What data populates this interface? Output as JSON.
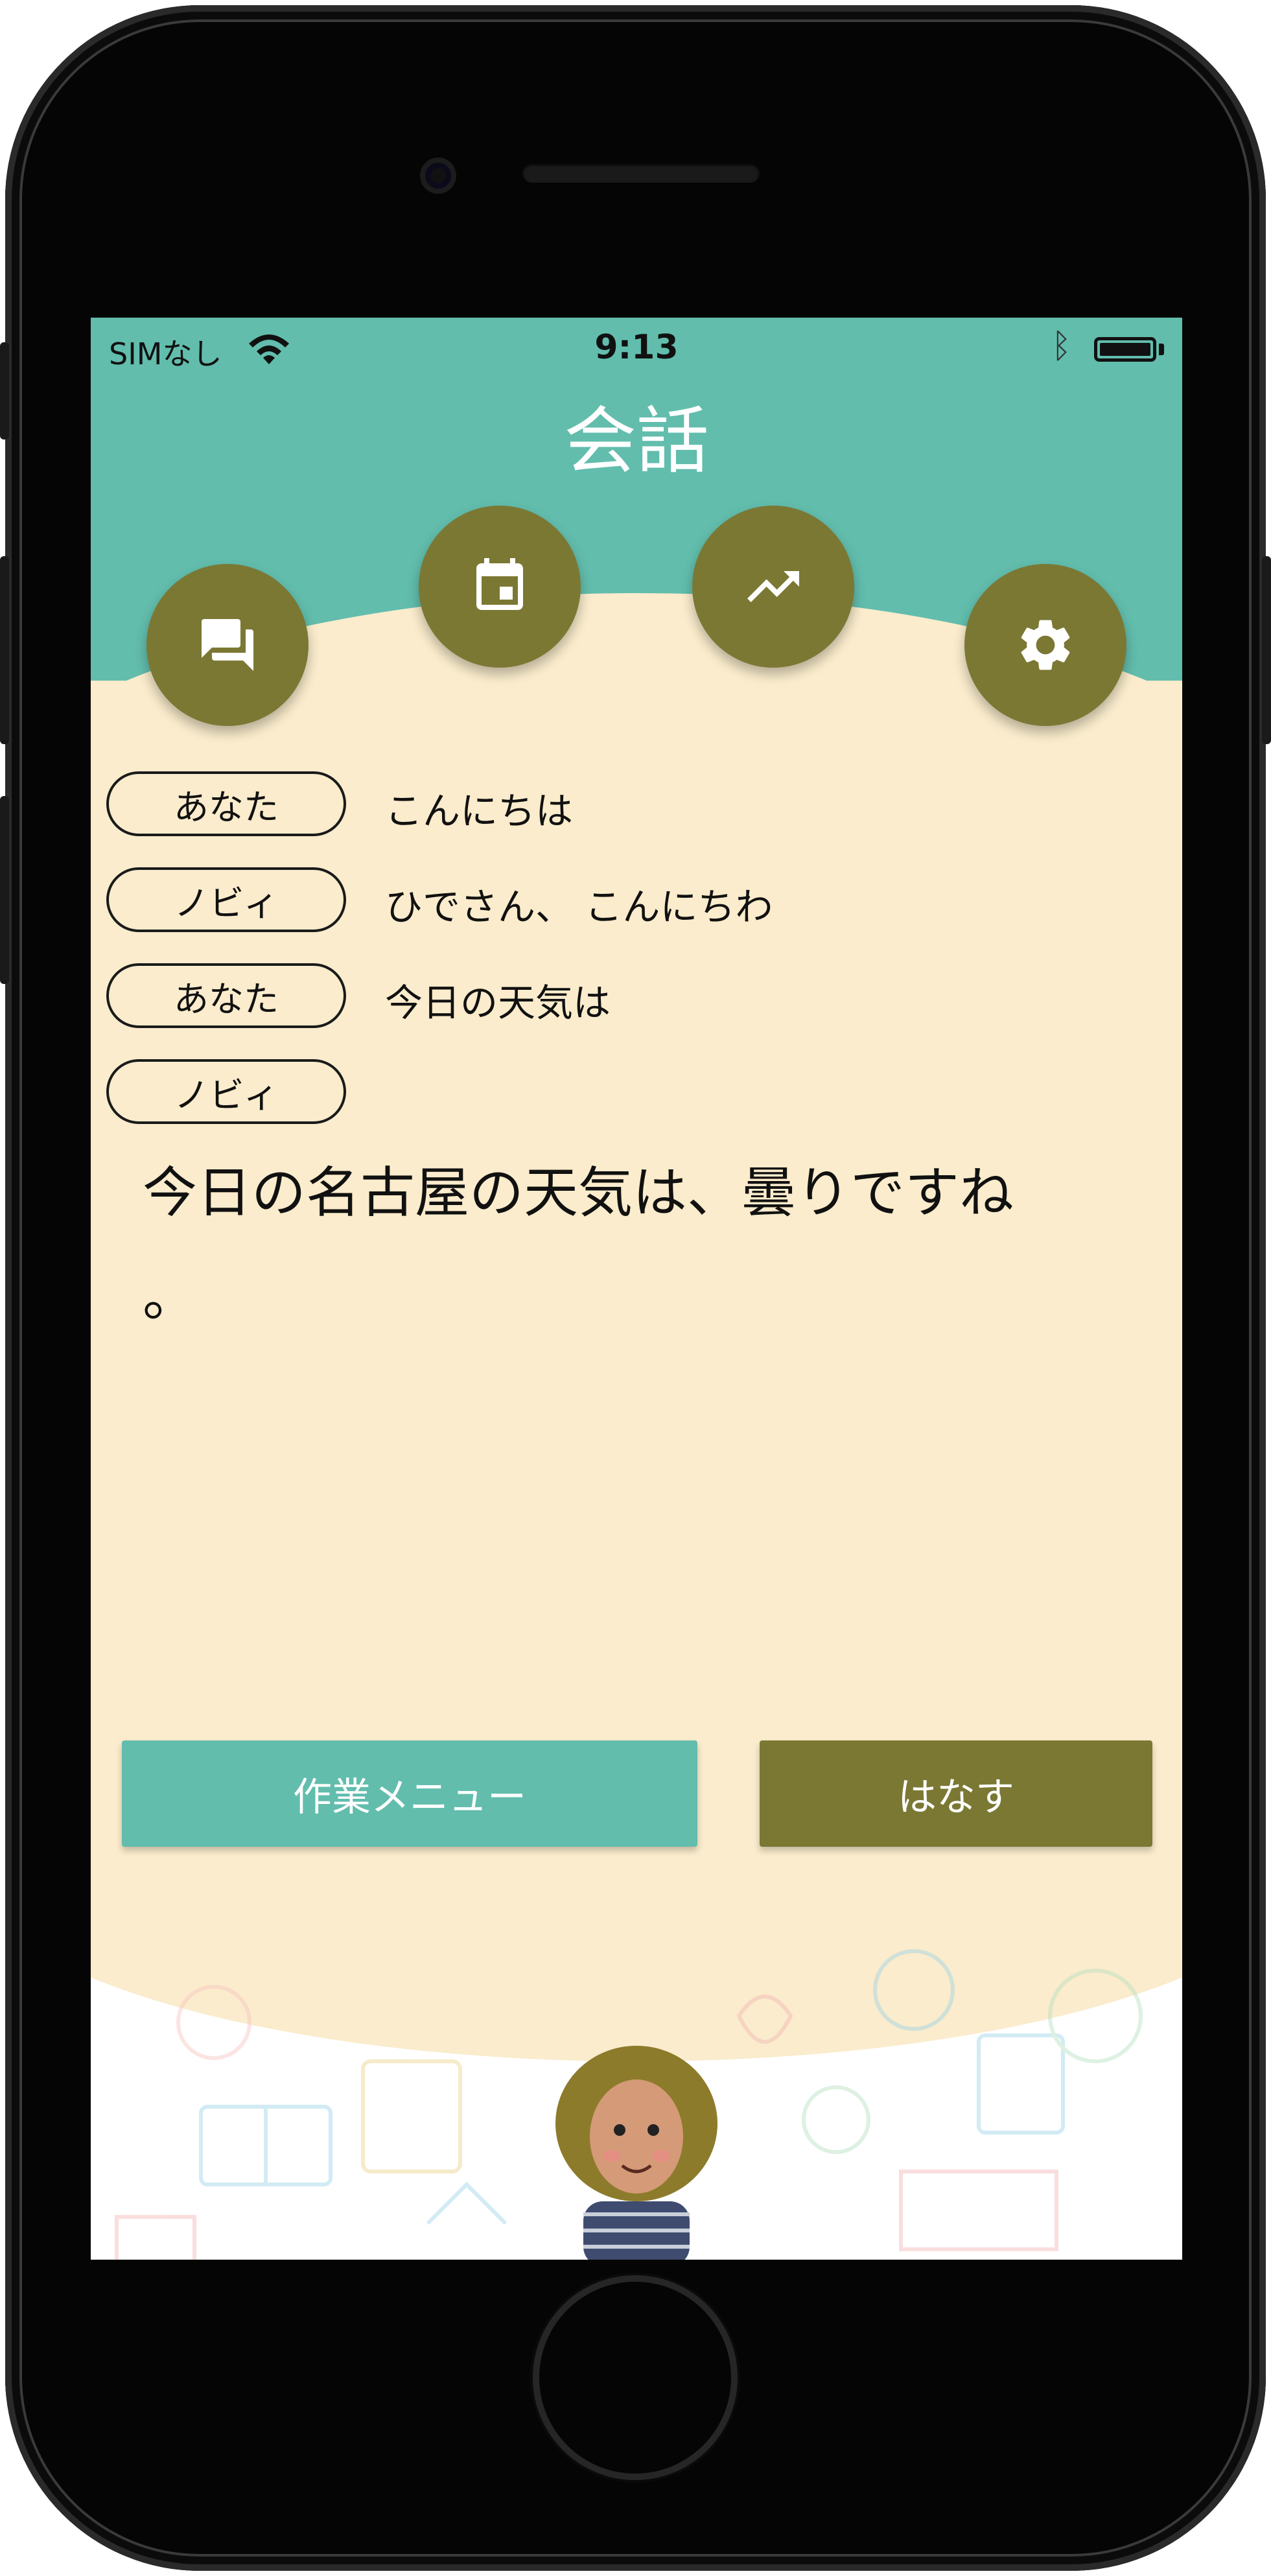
{
  "status_bar": {
    "carrier": "SIMなし",
    "time": "9:13",
    "wifi_icon": "wifi-icon",
    "bluetooth_icon": "bluetooth-icon",
    "battery_icon": "battery-icon"
  },
  "header": {
    "title": "会話"
  },
  "nav_buttons": [
    {
      "name": "chat",
      "icon": "chat-bubbles-icon"
    },
    {
      "name": "calendar",
      "icon": "calendar-icon"
    },
    {
      "name": "trending",
      "icon": "trending-up-icon"
    },
    {
      "name": "settings",
      "icon": "gear-icon"
    }
  ],
  "conversation": [
    {
      "speaker": "あなた",
      "text": "こんにちは"
    },
    {
      "speaker": "ノビィ",
      "text": "ひでさん、 こんにちわ"
    },
    {
      "speaker": "あなた",
      "text": "今日の天気は"
    },
    {
      "speaker": "ノビィ",
      "text": ""
    }
  ],
  "reply": {
    "line1": "今日の名古屋の天気は、曇りですね",
    "line2": "。"
  },
  "buttons": {
    "menu_label": "作業メニュー",
    "talk_label": "はなす"
  },
  "colors": {
    "teal": "#62bdad",
    "olive": "#7b7834",
    "cream": "#faeccc"
  }
}
